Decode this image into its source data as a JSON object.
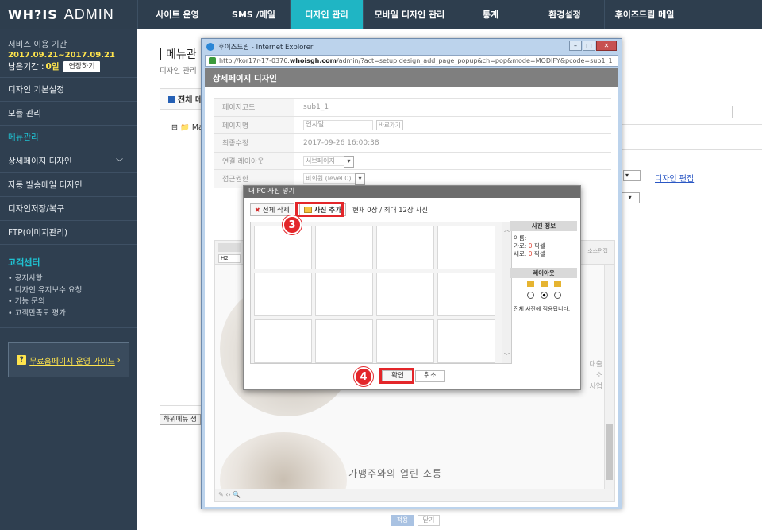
{
  "logo": {
    "mark": "WH?IS",
    "admin": "ADMIN"
  },
  "topnav": [
    {
      "label": "사이트 운영"
    },
    {
      "label": "SMS /메일"
    },
    {
      "label": "디자인 관리"
    },
    {
      "label": "모바일 디자인 관리"
    },
    {
      "label": "통계"
    },
    {
      "label": "환경설정"
    },
    {
      "label": "후이즈드림 메일"
    }
  ],
  "service": {
    "label": "서비스 이용 기간",
    "period": "2017.09.21~2017.09.21",
    "remain_label": "남은기간 :",
    "remain_value": "0일",
    "extend_button": "연장하기"
  },
  "sidebar_menu": [
    {
      "label": "디자인 기본설정"
    },
    {
      "label": "모듈 관리"
    },
    {
      "label": "메뉴관리"
    },
    {
      "label": "상세페이지 디자인"
    },
    {
      "label": "자동 발송메일 디자인"
    },
    {
      "label": "디자인저장/복구"
    },
    {
      "label": "FTP(이미지관리)"
    }
  ],
  "customer_center": {
    "title": "고객센터",
    "items": [
      "공지사항",
      "디자인 유지보수 요청",
      "기능 문의",
      "고객만족도 평가"
    ]
  },
  "guide_button": "무료홈페이지 운영 가이드",
  "page": {
    "title": "메뉴관",
    "breadcrumb": "디자인 관리",
    "panel_title": "전체 메",
    "tree_root": "Ma",
    "design_link": "디자인 편집",
    "sub_button": "하위메뉴 생"
  },
  "browser": {
    "title": "후이즈드림 - Internet Explorer",
    "url_prefix": "http://kor17r-17-0376.",
    "url_domain": "whoisgh.com",
    "url_rest": "/admin/?act=setup.design_add_page_popup&ch=pop&mode=MODIFY&pcode=sub1_1"
  },
  "popup": {
    "header": "상세페이지 디자인",
    "fields": [
      {
        "label": "페이지코드",
        "value": "sub1_1"
      },
      {
        "label": "페이지명",
        "value": "인사말",
        "button": "바로가기"
      },
      {
        "label": "최종수정",
        "value": "2017-09-26 16:00:38"
      },
      {
        "label": "연결 레이아웃",
        "value": "서브페이지"
      },
      {
        "label": "접근권한",
        "value": "비회원 (level 0)"
      }
    ],
    "editor_format": "H2",
    "slogan": "가맹주와의 열린 소통",
    "side_text": [
      "대출",
      "소",
      "사업"
    ],
    "source_edit": "소스편집",
    "apply_button": "적용",
    "close_button": "닫기"
  },
  "modal": {
    "title": "내 PC 사진 넣기",
    "delete_all": "전체 삭제",
    "add_photo": "사진 추가",
    "count_text": "현재 0장 / 최대 12장 사진",
    "info_title": "사진 정보",
    "info_name": "이름:",
    "info_width_label": "가로:",
    "info_width_value": "0",
    "info_height_label": "세로:",
    "info_height_value": "0",
    "info_unit": "픽셀",
    "layout_title": "레이아웃",
    "layout_note": "전체 사진에 적용됩니다.",
    "ok_button": "확인",
    "cancel_button": "취소"
  },
  "steps": {
    "three": "3",
    "four": "4"
  },
  "colors": {
    "accent": "#1fb5c4",
    "highlight": "#e3262a",
    "nav_bg": "#2e3e4e"
  }
}
